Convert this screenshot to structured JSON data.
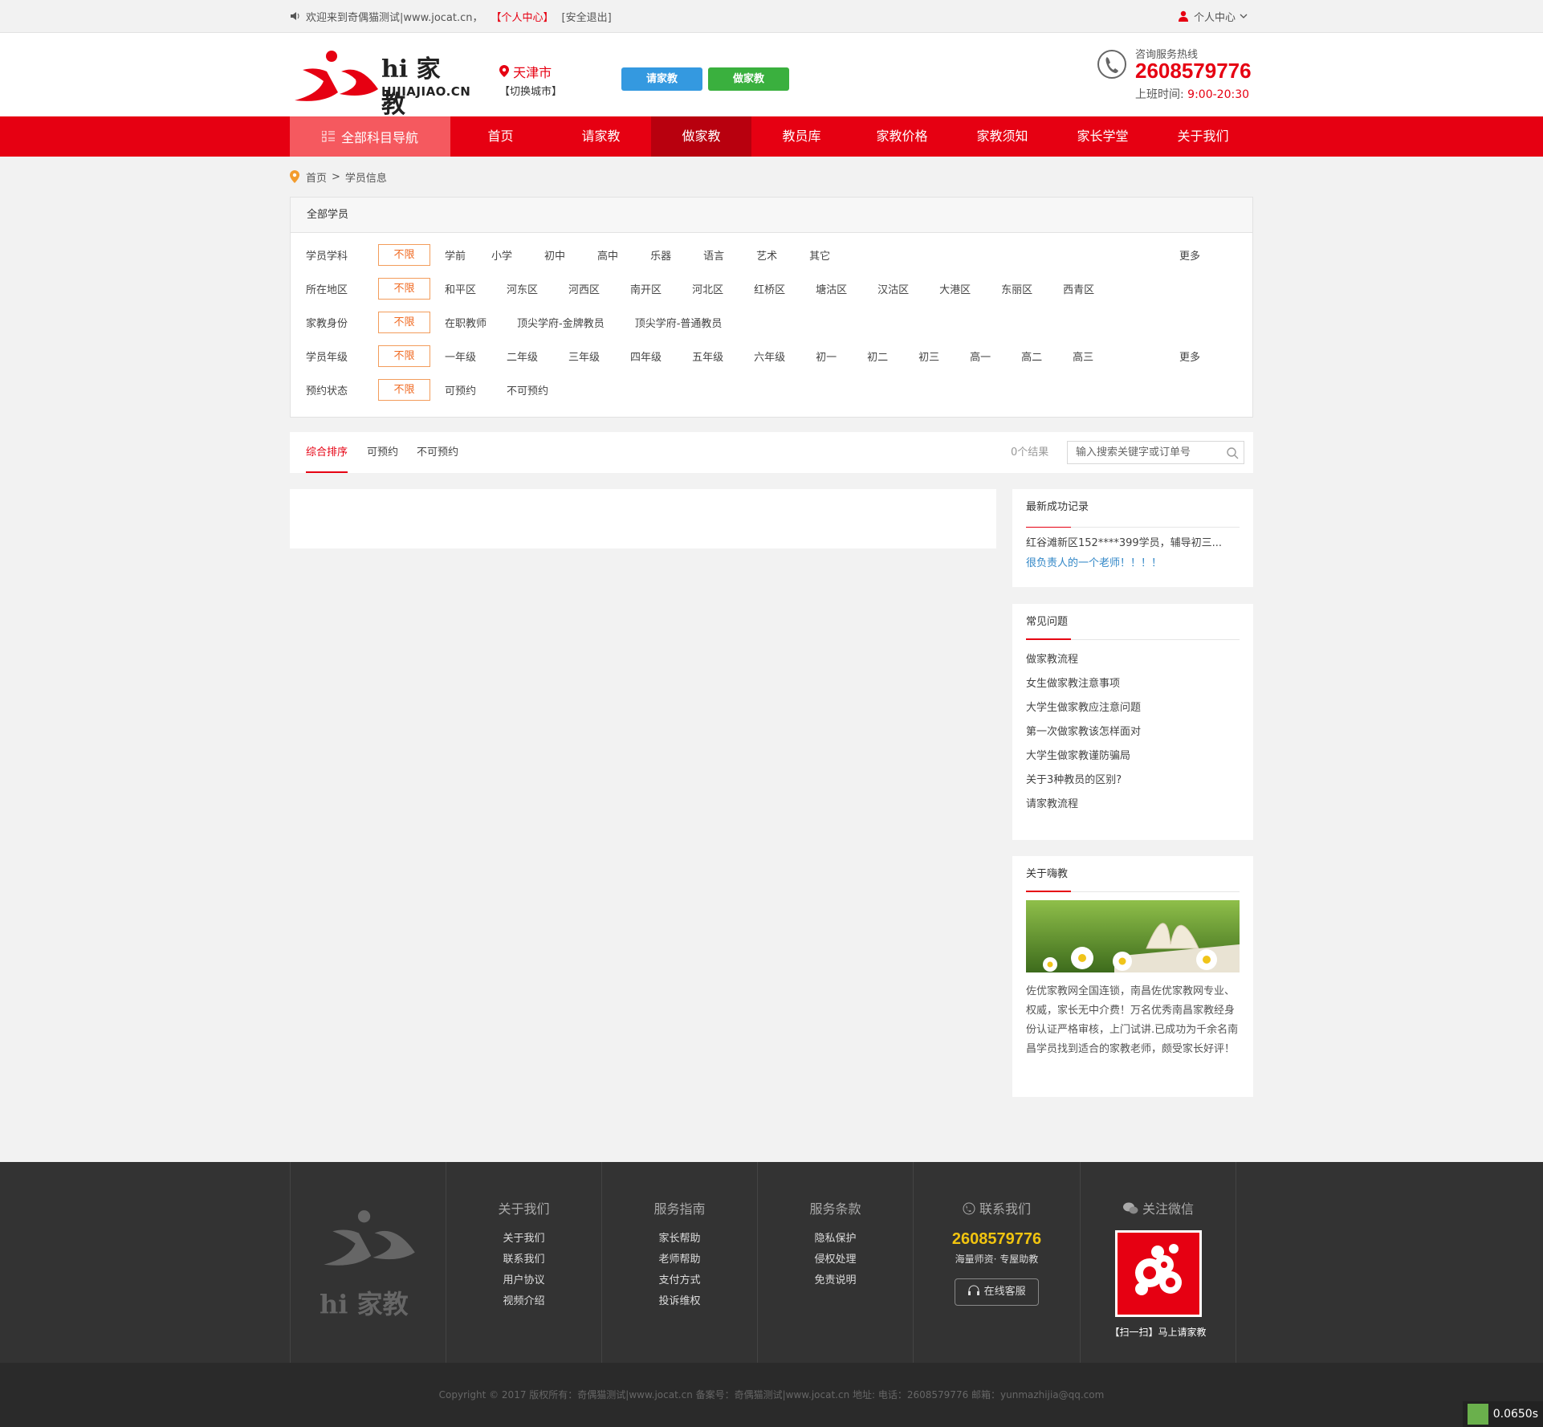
{
  "topbar": {
    "welcome": "欢迎来到奇偶猫测试|www.jocat.cn，",
    "personal_center_link": "【个人中心】",
    "logout_link": "[安全退出]",
    "user_menu": "个人中心"
  },
  "header": {
    "logo_text": "hi 家教",
    "logo_domain": "HIJIAJIAO.CN",
    "city_name": "天津市",
    "city_switch": "【切换城市】",
    "btn_request": "请家教",
    "btn_be_tutor": "做家教",
    "hotline_label": "咨询服务热线",
    "hotline_number": "2608579776",
    "hours_label": "上班时间:",
    "hours_value": "9:00-20:30"
  },
  "nav": {
    "all_subjects": "全部科目导航",
    "items": [
      "首页",
      "请家教",
      "做家教",
      "教员库",
      "家教价格",
      "家教须知",
      "家长学堂",
      "关于我们"
    ],
    "active_index": 2
  },
  "breadcrumb": {
    "home": "首页",
    "sep": ">",
    "current": "学员信息"
  },
  "filter": {
    "header": "全部学员",
    "no_limit": "不限",
    "more": "更多",
    "rows": [
      {
        "label": "学员学科",
        "options": [
          "学前",
          "小学",
          "初中",
          "高中",
          "乐器",
          "语言",
          "艺术",
          "其它"
        ]
      },
      {
        "label": "所在地区",
        "options": [
          "和平区",
          "河东区",
          "河西区",
          "南开区",
          "河北区",
          "红桥区",
          "塘沽区",
          "汉沽区",
          "大港区",
          "东丽区",
          "西青区"
        ]
      },
      {
        "label": "家教身份",
        "options": [
          "在职教师",
          "顶尖学府-金牌教员",
          "顶尖学府-普通教员"
        ]
      },
      {
        "label": "学员年级",
        "options": [
          "一年级",
          "二年级",
          "三年级",
          "四年级",
          "五年级",
          "六年级",
          "初一",
          "初二",
          "初三",
          "高一",
          "高二",
          "高三"
        ]
      },
      {
        "label": "预约状态",
        "options": [
          "可预约",
          "不可预约"
        ]
      }
    ]
  },
  "sortbar": {
    "tabs": [
      "综合排序",
      "可预约",
      "不可预约"
    ],
    "result_count": "0个结果",
    "search_placeholder": "输入搜索关键字或订单号"
  },
  "sidebar": {
    "recent_title": "最新成功记录",
    "recent_line1": "红谷滩新区152****399学员，辅导初三...",
    "recent_line2": "很负责人的一个老师！！！！",
    "faq_title": "常见问题",
    "faq_items": [
      "做家教流程",
      "女生做家教注意事项",
      "大学生做家教应注意问题",
      "第一次做家教该怎样面对",
      "大学生做家教谨防骗局",
      "关于3种教员的区别?",
      "请家教流程"
    ],
    "about_title": "关于嗨教",
    "about_text": "佐优家教网全国连锁，南昌佐优家教网专业、权威，家长无中介费！万名优秀南昌家教经身份认证严格审核，上门试讲.已成功为千余名南昌学员找到适合的家教老师，颇受家长好评！"
  },
  "footer": {
    "logo_text": "hi 家教",
    "col_about": {
      "title": "关于我们",
      "items": [
        "关于我们",
        "联系我们",
        "用户协议",
        "视频介绍"
      ]
    },
    "col_guide": {
      "title": "服务指南",
      "items": [
        "家长帮助",
        "老师帮助",
        "支付方式",
        "投诉维权"
      ]
    },
    "col_terms": {
      "title": "服务条款",
      "items": [
        "隐私保护",
        "侵权处理",
        "免责说明"
      ]
    },
    "contact_title": "联系我们",
    "contact_number": "2608579776",
    "contact_sub": "海量师资· 专屋助教",
    "online_service": "在线客服",
    "wechat_title": "关注微信",
    "wechat_caption": "【扫一扫】马上请家教",
    "copyright": "Copyright © 2017 版权所有：奇偶猫测试|www.jocat.cn    备案号：奇偶猫测试|www.jocat.cn    地址:     电话：2608579776     邮箱：yunmazhijia@qq.com"
  },
  "timer": "0.0650s",
  "colors": {
    "brand_red": "#e60012",
    "nav_active": "#b8000e",
    "nav_all": "#f5595f",
    "btn_blue": "#3499e0",
    "btn_green": "#3ab03e",
    "no_limit_orange": "#f06a22",
    "hotline_yellow": "#f1c40f"
  }
}
